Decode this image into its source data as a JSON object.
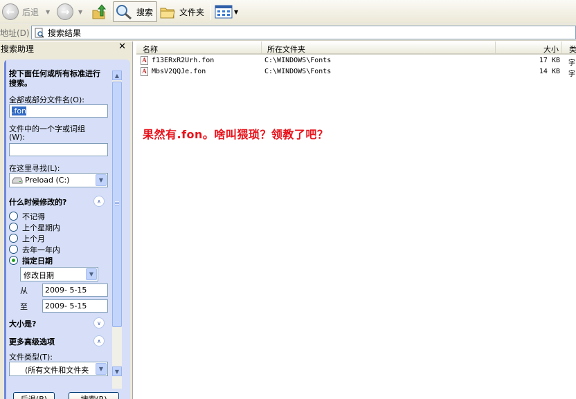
{
  "toolbar": {
    "back_label": "后退",
    "search_label": "搜索",
    "folders_label": "文件夹"
  },
  "address": {
    "label": "地址(D)",
    "value": "搜索结果"
  },
  "search_pane": {
    "title": "搜索助理",
    "heading": "按下面任何或所有标准进行搜索。",
    "filename_label": "全部或部分文件名(O):",
    "filename_value": ".fon",
    "phrase_label_1": "文件中的一个字或词组",
    "phrase_label_2": "(W):",
    "phrase_value": "",
    "lookin_label": "在这里寻找(L):",
    "lookin_value": "Preload (C:)",
    "when_heading": "什么时候修改的?",
    "when_options": [
      "不记得",
      "上个星期内",
      "上个月",
      "去年一年内",
      "指定日期"
    ],
    "when_selected": "指定日期",
    "date_type_value": "修改日期",
    "from_label": "从",
    "from_value": "2009- 5-15",
    "to_label": "至",
    "to_value": "2009- 5-15",
    "size_heading": "大小是?",
    "advanced_heading": "更多高级选项",
    "filetype_label": "文件类型(T):",
    "filetype_value": "(所有文件和文件夹",
    "back_button": "后退(B)",
    "search_button": "搜索(R)"
  },
  "list": {
    "columns": [
      "名称",
      "所在文件夹",
      "大小",
      "类"
    ],
    "rows": [
      {
        "name": "f13ERxR2Urh.fon",
        "folder": "C:\\WINDOWS\\Fonts",
        "size": "17 KB",
        "type": "字"
      },
      {
        "name": "MbsV2QQJe.fon",
        "folder": "C:\\WINDOWS\\Fonts",
        "size": "14 KB",
        "type": "字"
      }
    ]
  },
  "annotation": "果然有.fon。啥叫猥琐？领教了吧？",
  "colors": {
    "annotation": "#e8121b",
    "pane_bg": "#d6dff7",
    "selection": "#316ac5"
  }
}
